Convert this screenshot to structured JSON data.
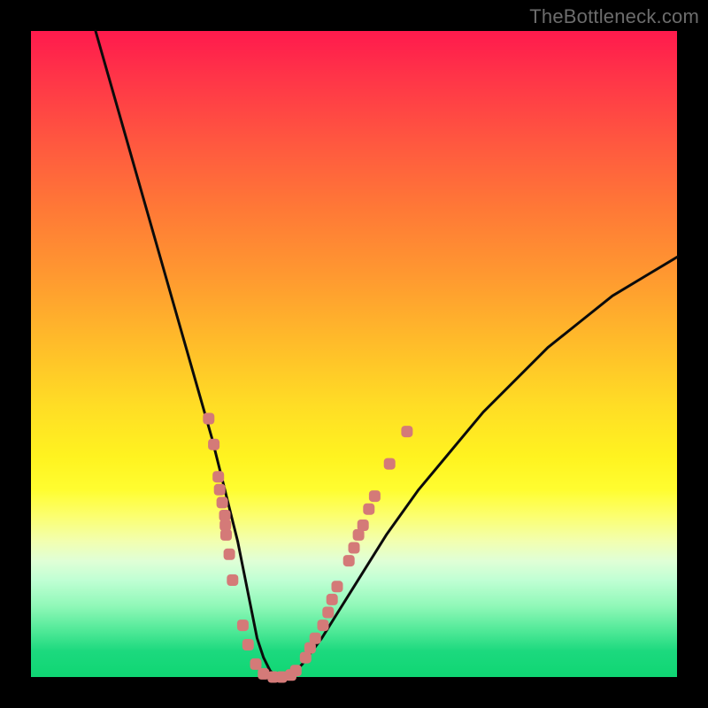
{
  "watermark": "TheBottleneck.com",
  "colors": {
    "background_black": "#000000",
    "curve_black": "#0b0b0b",
    "marker_fill": "#d47a78",
    "gradient_top": "#ff1a4d",
    "gradient_bottom": "#0fd673"
  },
  "chart_data": {
    "type": "line",
    "title": "",
    "xlabel": "",
    "ylabel": "",
    "xlim": [
      0,
      100
    ],
    "ylim": [
      0,
      100
    ],
    "grid": false,
    "legend": false,
    "annotations": [
      "TheBottleneck.com"
    ],
    "series": [
      {
        "name": "bottleneck-curve",
        "x": [
          10,
          12,
          14,
          16,
          18,
          20,
          22,
          24,
          26,
          28,
          30,
          31,
          32,
          33,
          34,
          35,
          36,
          37,
          38,
          40,
          42,
          45,
          50,
          55,
          60,
          65,
          70,
          75,
          80,
          85,
          90,
          95,
          100
        ],
        "y": [
          100,
          93,
          86,
          79,
          72,
          65,
          58,
          51,
          44,
          37,
          29,
          25,
          21,
          16,
          11,
          6,
          3,
          1,
          0,
          0,
          2,
          6,
          14,
          22,
          29,
          35,
          41,
          46,
          51,
          55,
          59,
          62,
          65
        ]
      }
    ],
    "markers": [
      {
        "x": 27.5,
        "y": 40
      },
      {
        "x": 28.3,
        "y": 36
      },
      {
        "x": 29.0,
        "y": 31
      },
      {
        "x": 29.2,
        "y": 29
      },
      {
        "x": 29.6,
        "y": 27
      },
      {
        "x": 30.0,
        "y": 25
      },
      {
        "x": 30.1,
        "y": 23.5
      },
      {
        "x": 30.2,
        "y": 22
      },
      {
        "x": 30.7,
        "y": 19
      },
      {
        "x": 31.2,
        "y": 15
      },
      {
        "x": 32.8,
        "y": 8
      },
      {
        "x": 33.6,
        "y": 5
      },
      {
        "x": 34.8,
        "y": 2
      },
      {
        "x": 36.0,
        "y": 0.5
      },
      {
        "x": 37.5,
        "y": 0
      },
      {
        "x": 38.8,
        "y": 0
      },
      {
        "x": 40.2,
        "y": 0.3
      },
      {
        "x": 41.0,
        "y": 1
      },
      {
        "x": 42.5,
        "y": 3
      },
      {
        "x": 43.2,
        "y": 4.5
      },
      {
        "x": 44.0,
        "y": 6
      },
      {
        "x": 45.2,
        "y": 8
      },
      {
        "x": 46.0,
        "y": 10
      },
      {
        "x": 46.6,
        "y": 12
      },
      {
        "x": 47.4,
        "y": 14
      },
      {
        "x": 49.2,
        "y": 18
      },
      {
        "x": 50.0,
        "y": 20
      },
      {
        "x": 50.7,
        "y": 22
      },
      {
        "x": 51.4,
        "y": 23.5
      },
      {
        "x": 52.3,
        "y": 26
      },
      {
        "x": 53.2,
        "y": 28
      },
      {
        "x": 55.5,
        "y": 33
      },
      {
        "x": 58.2,
        "y": 38
      }
    ]
  }
}
